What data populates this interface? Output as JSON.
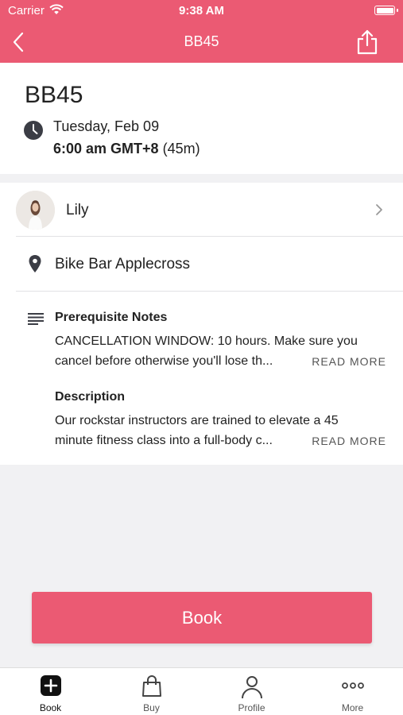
{
  "status_bar": {
    "carrier": "Carrier",
    "time": "9:38 AM"
  },
  "nav": {
    "title": "BB45"
  },
  "class_info": {
    "title": "BB45",
    "date": "Tuesday, Feb 09",
    "time": "6:00 am GMT+8",
    "duration": "(45m)"
  },
  "instructor": {
    "name": "Lily"
  },
  "location": {
    "name": "Bike Bar Applecross"
  },
  "notes": {
    "heading": "Prerequisite Notes",
    "line1": "CANCELLATION WINDOW: 10 hours. Make sure you",
    "line2": "cancel before otherwise you'll lose th...",
    "read_more": "READ MORE"
  },
  "description": {
    "heading": "Description",
    "line1": "Our rockstar instructors are trained to elevate a 45",
    "line2": "minute fitness class into a full-body c...",
    "read_more": "READ MORE"
  },
  "book_button": {
    "label": "Book"
  },
  "tabs": [
    {
      "label": "Book",
      "icon": "plus-square-icon",
      "active": true
    },
    {
      "label": "Buy",
      "icon": "shopping-bag-icon",
      "active": false
    },
    {
      "label": "Profile",
      "icon": "person-icon",
      "active": false
    },
    {
      "label": "More",
      "icon": "more-dots-icon",
      "active": false
    }
  ],
  "colors": {
    "accent": "#eb5a73"
  }
}
